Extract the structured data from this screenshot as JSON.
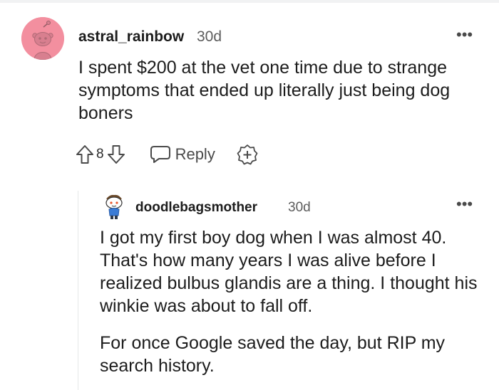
{
  "comments": [
    {
      "author": "astral_rainbow",
      "age": "30d",
      "paragraphs": [
        "I spent $200 at the vet one time due to strange symptoms that ended up literally just being dog boners"
      ],
      "vote_count": "8",
      "reply_label": "Reply",
      "avatar_color": "#f38f9f"
    },
    {
      "author": "doodlebagsmother",
      "age": "30d",
      "paragraphs": [
        "I got my first boy dog when I was almost 40. That's how many years I was alive before I realized bulbus glandis are a thing. I thought his winkie was about to fall off.",
        "For once Google saved the day, but RIP my search history."
      ]
    }
  ],
  "icons": {
    "menu": "more-options-icon",
    "upvote": "upvote-arrow-icon",
    "downvote": "downvote-arrow-icon",
    "reply": "speech-bubble-icon",
    "award": "award-plus-icon"
  },
  "menu_glyph": "•••"
}
